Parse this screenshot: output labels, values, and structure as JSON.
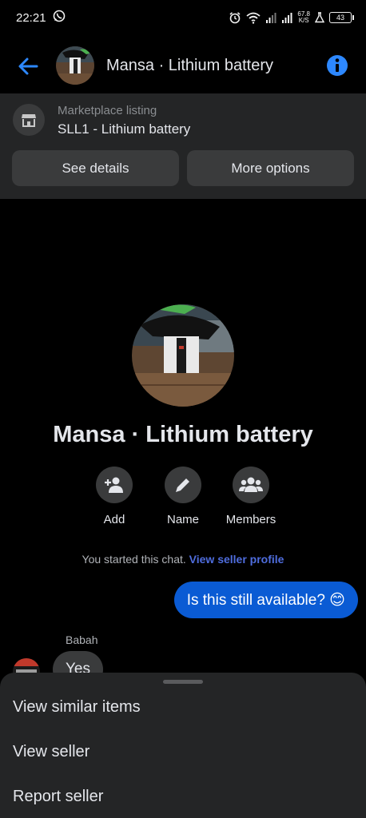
{
  "status_bar": {
    "time": "22:21",
    "left_icon": "whatsapp-icon",
    "net_speed_value": "67.8",
    "net_speed_unit": "K/S",
    "battery": "43",
    "icons": [
      "alarm-icon",
      "wifi-icon",
      "signal-icon",
      "signal-icon",
      "speed-indicator",
      "flask-icon",
      "battery-icon"
    ]
  },
  "header": {
    "title": "Mansa · Lithium battery",
    "back_icon": "back-arrow-icon",
    "info_icon": "info-icon"
  },
  "listing": {
    "label": "Marketplace listing",
    "name": "SLL1 - Lithium battery",
    "icon": "shop-icon",
    "buttons": {
      "details": "See details",
      "options": "More options"
    }
  },
  "profile": {
    "name": "Mansa · Lithium battery",
    "actions": [
      {
        "label": "Add",
        "icon": "add-person-icon"
      },
      {
        "label": "Name",
        "icon": "pencil-icon"
      },
      {
        "label": "Members",
        "icon": "members-icon"
      }
    ]
  },
  "chat": {
    "started_text": "You started this chat.",
    "started_link": "View seller profile",
    "messages": [
      {
        "from": "me",
        "text": "Is this still available? 😊"
      },
      {
        "from": "Babah",
        "text": "Yes"
      }
    ],
    "sender_name": "Babah"
  },
  "sheet": {
    "items": [
      "View similar items",
      "View seller",
      "Report seller"
    ]
  },
  "colors": {
    "accent": "#0a5bd4",
    "link": "#4f6dde",
    "surface": "#242526",
    "button": "#3a3b3c"
  }
}
